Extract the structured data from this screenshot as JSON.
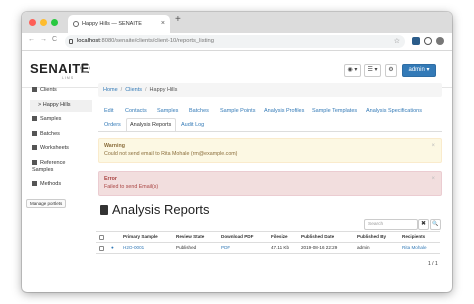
{
  "browser": {
    "tab_title": "Happy Hills — SENAITE",
    "tab_close": "×",
    "new_tab": "+",
    "url_host": "localhost",
    "url_path": ":8080/senaite/clients/client-10/reports_listing",
    "back": "←",
    "forward": "→",
    "reload": "C"
  },
  "header": {
    "logo": "SENAITE",
    "logo_sub": "LIMS",
    "buttons": [
      "◉ ▾",
      "☰ ▾",
      "⚙",
      "admin ▾"
    ]
  },
  "sidebar": {
    "items": [
      {
        "label": "Clients"
      },
      {
        "label": "> Happy Hills"
      },
      {
        "label": "Samples"
      },
      {
        "label": "Batches"
      },
      {
        "label": "Worksheets"
      },
      {
        "label": "Reference"
      },
      {
        "label": "Samples"
      },
      {
        "label": "Methods"
      }
    ],
    "manage": "Manage portlets"
  },
  "breadcrumb": {
    "items": [
      "Home",
      "Clients",
      "Happy Hills"
    ],
    "sep": "/"
  },
  "tabs_row1": [
    "Edit",
    "Contacts",
    "Samples",
    "Batches",
    "Sample Points",
    "Analysis Profiles",
    "Sample Templates",
    "Analysis Specifications"
  ],
  "tabs_row2": [
    "Orders",
    "Analysis Reports",
    "Audit Log"
  ],
  "alerts": {
    "warning_title": "Warning",
    "warning_text": "Could not send email to Rita Mohale (rm@example.com)",
    "error_title": "Error",
    "error_text": "Failed to send Email(s)",
    "close": "×"
  },
  "page_title": "Analysis Reports",
  "search": {
    "placeholder": "Search",
    "clear": "✖",
    "go": "🔍"
  },
  "table": {
    "columns": [
      "Primary Sample",
      "Review State",
      "Download PDF",
      "Filesize",
      "Published Date",
      "Published By",
      "Recipients"
    ],
    "rows": [
      {
        "sample": "H2O-0001",
        "state": "Published",
        "pdf": "PDF",
        "size": "47.11 Kb",
        "date": "2019-08-16 22:29",
        "by": "admin",
        "recipients": "Rita Mohale"
      }
    ],
    "pager": "1 / 1"
  }
}
